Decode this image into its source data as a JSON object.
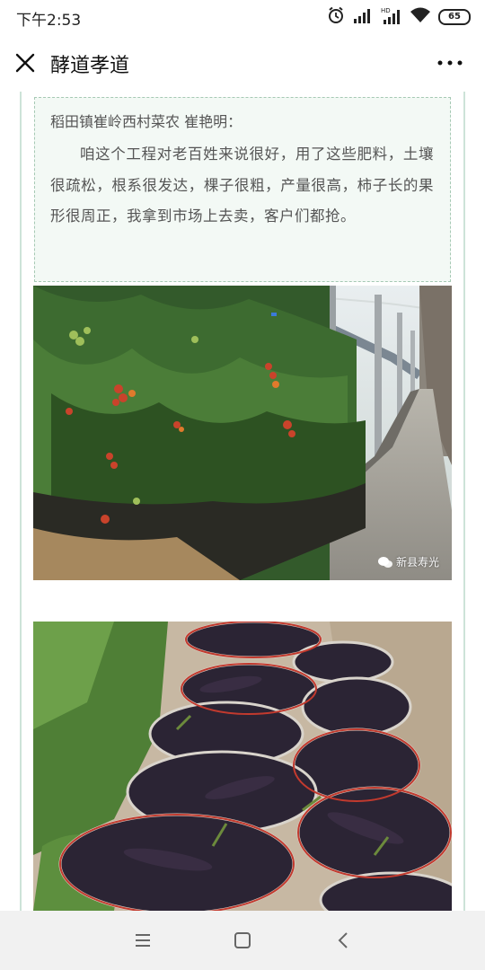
{
  "status_bar": {
    "time": "下午2:53",
    "battery": "65",
    "icons": [
      "alarm-clock-icon",
      "signal-icon",
      "signal-hd-icon",
      "wifi-icon",
      "battery-icon"
    ]
  },
  "title_bar": {
    "title": "酵道孝道",
    "close_icon": "close-icon",
    "more_icon": "more-dots-icon"
  },
  "article": {
    "quote": {
      "speaker": "稻田镇崔岭西村菜农 崔艳明：",
      "body": "咱这个工程对老百姓来说很好，用了这些肥料，土壤很疏松，根系很发达，棵子很粗，产量很高，柿子长的果形很周正，我拿到市场上去卖，客户们都抢。"
    },
    "images": [
      {
        "subject": "greenhouse-tomato-plants",
        "watermark": "新县寿光"
      },
      {
        "subject": "harvested-eggplants-in-baskets"
      }
    ]
  },
  "nav_bar": {
    "buttons": [
      "menu-icon",
      "home-icon",
      "back-icon"
    ]
  },
  "colors": {
    "quote_bg": "#f3f9f5",
    "quote_border": "#a6c9b4",
    "frame_line": "#cde3d8",
    "nav_bg": "#f1f1f1"
  }
}
